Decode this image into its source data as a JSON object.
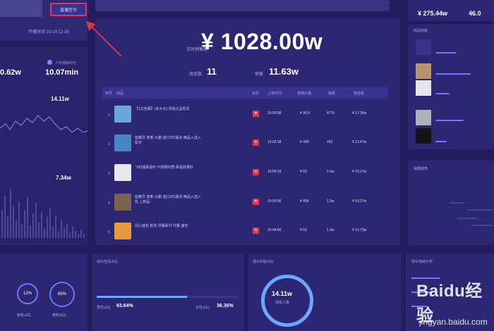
{
  "header": {
    "live_button": "直播控台",
    "time": "开播时间 10-19 12:39"
  },
  "left": {
    "stat_left_value": "0.62w",
    "stat_left_label": "",
    "stat_right_value": "10.07min",
    "stat_right_label": "人均观看时长",
    "metric1_value": "14.11w",
    "metric2_value": "7.34w"
  },
  "center": {
    "sales_label": "实时销售额",
    "sales_value": "¥ 1028.00w",
    "goods_label": "商品数",
    "goods_value": "11",
    "orders_label": "销量",
    "orders_value": "11.63w",
    "table_headers": [
      "序号",
      "商品",
      "状态",
      "上架时间",
      "直播价格",
      "销量",
      "销售额"
    ],
    "rows": [
      {
        "idx": "1",
        "name": "【1元包邮】(买大大) 原装正品现货",
        "time": "19:09:58",
        "price": "¥ 36.9",
        "qty": "4776",
        "amount": "¥ 17.36w",
        "img": "#6aa8d8"
      },
      {
        "idx": "2",
        "name": "蓝精灵 意乘·大鹏·蓝口2代版本 精品入选入机无",
        "time": "19:02:18",
        "price": "¥ 499",
        "qty": "256",
        "amount": "¥ 12.47w",
        "img": "#4a86c6"
      },
      {
        "idx": "3",
        "name": "飞利浦保温杯 不锈钢材质 保温效果好",
        "time": "19:00:18",
        "price": "¥ 69",
        "qty": "1.5w",
        "amount": "¥ 70.27w",
        "img": "#e8e8ee"
      },
      {
        "idx": "4",
        "name": "蓝精灵 意乘·大鹏·蓝口2代版本 精品入选入机 上新品",
        "time": "19:50:06",
        "price": "¥ 499",
        "qty": "1.9w",
        "amount": "¥ 93.27w",
        "img": "#7a6450"
      },
      {
        "idx": "5",
        "name": "白心面包 板亮 早餐系列 代餐 面包",
        "time": "20:44:40",
        "price": "¥ 59",
        "qty": "1.3w",
        "amount": "¥ 12.73w",
        "img": "#e89a3a"
      }
    ]
  },
  "right": {
    "top_value": "¥ 275.44w",
    "top_value2": "46.0",
    "goods_title": "商品热度",
    "chart_title": "销量趋势"
  },
  "bottom": {
    "ring1": "12%",
    "ring2": "65%",
    "ring1_label": "新粉占比",
    "ring2_label": "老粉占比",
    "panel2_title": "观众性别占比",
    "male_label": "男性占比",
    "male_value": "63.64%",
    "female_label": "女性占比",
    "female_value": "36.36%",
    "panel3_title": "观众年龄占比",
    "center_ring_value": "14.11w",
    "center_ring_label": "观看人数",
    "panel4_title": "观众地域分布"
  },
  "watermark": {
    "brand": "Baidu经验",
    "url": "jingyan.baidu.com"
  }
}
